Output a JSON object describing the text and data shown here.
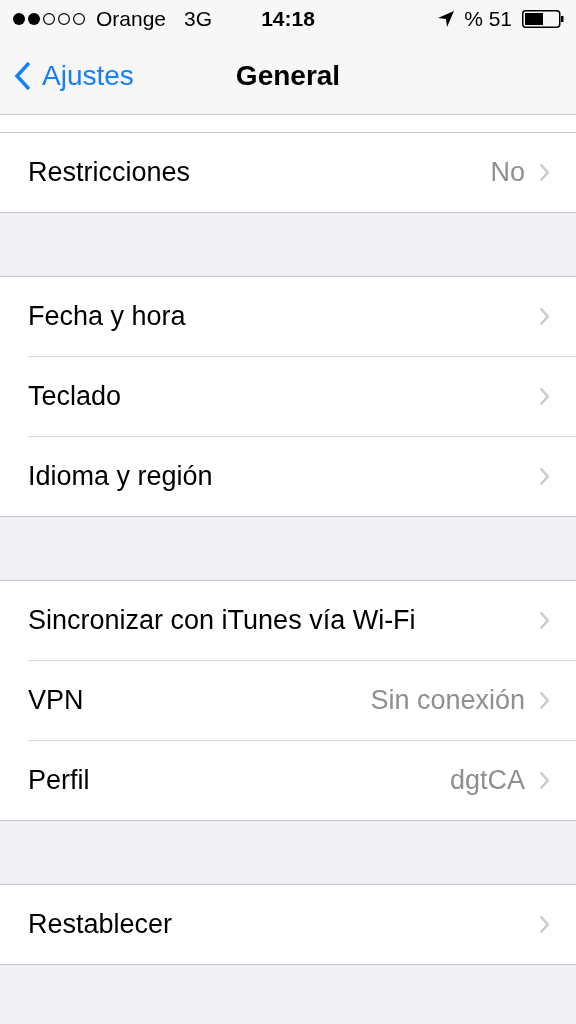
{
  "status_bar": {
    "carrier": "Orange",
    "network": "3G",
    "time": "14:18",
    "battery": "% 51"
  },
  "nav_bar": {
    "back": "Ajustes",
    "title": "General"
  },
  "groups": [
    {
      "rows": [
        {
          "label": "Restricciones",
          "value": "No"
        }
      ]
    },
    {
      "rows": [
        {
          "label": "Fecha y hora"
        },
        {
          "label": "Teclado"
        },
        {
          "label": "Idioma y región"
        }
      ]
    },
    {
      "rows": [
        {
          "label": "Sincronizar con iTunes vía Wi-Fi"
        },
        {
          "label": "VPN",
          "value": "Sin conexión"
        },
        {
          "label": "Perfil",
          "value": "dgtCA"
        }
      ]
    },
    {
      "rows": [
        {
          "label": "Restablecer"
        }
      ]
    }
  ]
}
